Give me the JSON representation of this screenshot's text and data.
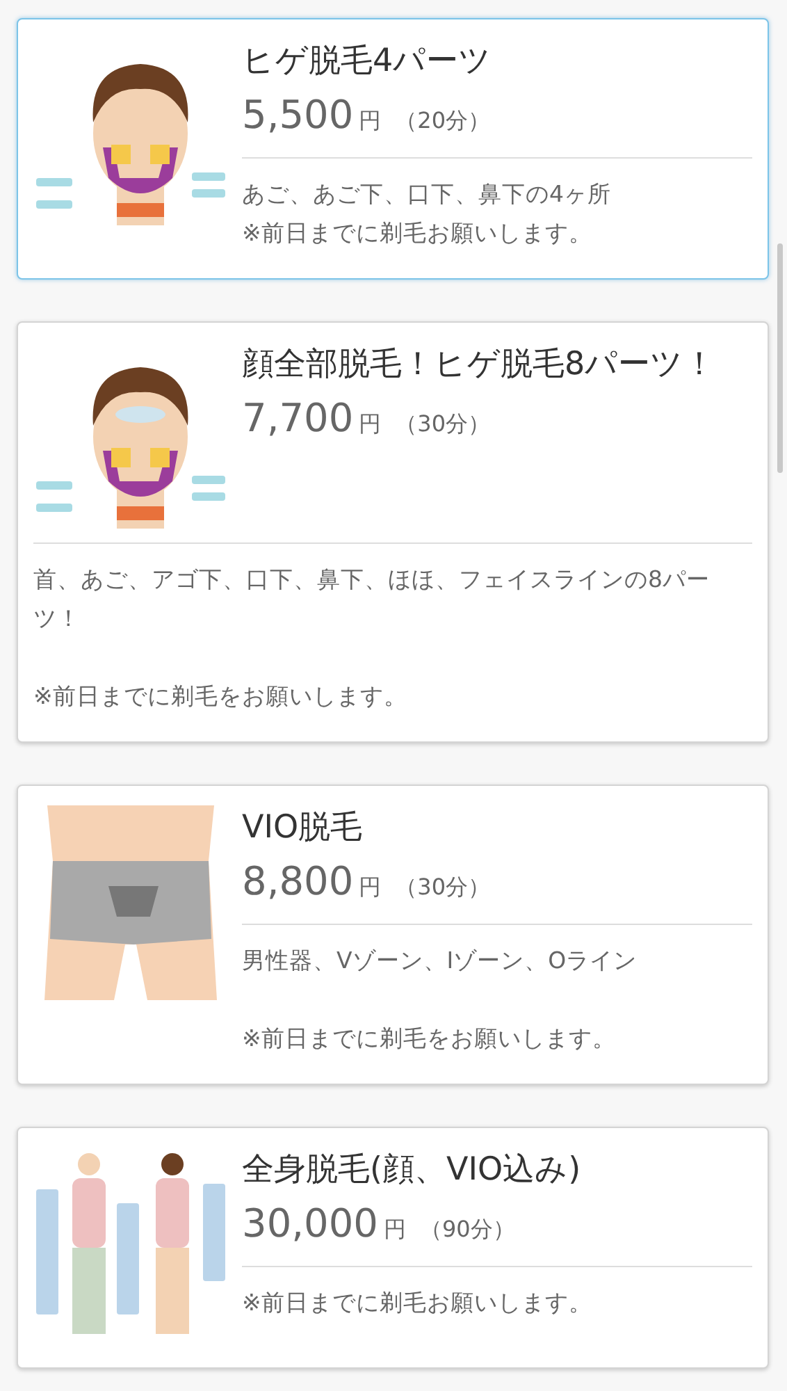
{
  "menu_items": [
    {
      "kind": "beard",
      "title": "ヒゲ脱毛4パーツ",
      "price": "5,500",
      "unit": "円",
      "duration": "（20分）",
      "selected": true,
      "description": "あご、あご下、口下、鼻下の4ヶ所\n※前日までに剃毛お願いします。"
    },
    {
      "kind": "face",
      "title": "顔全部脱毛！ヒゲ脱毛8パーツ！",
      "price": "7,700",
      "unit": "円",
      "duration": "（30分）",
      "selected": false,
      "description": "首、あご、アゴ下、口下、鼻下、ほほ、フェイスラインの8パーツ！\n\n※前日までに剃毛をお願いします。"
    },
    {
      "kind": "vio",
      "title": "VIO脱毛",
      "price": "8,800",
      "unit": "円",
      "duration": "（30分）",
      "selected": false,
      "description": "男性器、Vゾーン、Iゾーン、Oライン\n\n※前日までに剃毛をお願いします。"
    },
    {
      "kind": "body",
      "title": "全身脱毛(顔、VIO込み)",
      "price": "30,000",
      "unit": "円",
      "duration": "（90分）",
      "selected": false,
      "description": "※前日までに剃毛お願いします。"
    }
  ]
}
